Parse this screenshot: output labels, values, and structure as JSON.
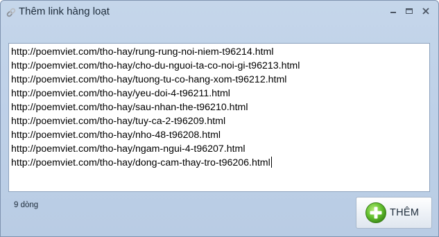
{
  "window": {
    "title": "Thêm link hàng loạt",
    "icon": "link-icon"
  },
  "textarea": {
    "lines": [
      "http://poemviet.com/tho-hay/rung-rung-noi-niem-t96214.html",
      "http://poemviet.com/tho-hay/cho-du-nguoi-ta-co-noi-gi-t96213.html",
      "http://poemviet.com/tho-hay/tuong-tu-co-hang-xom-t96212.html",
      "http://poemviet.com/tho-hay/yeu-doi-4-t96211.html",
      "http://poemviet.com/tho-hay/sau-nhan-the-t96210.html",
      "http://poemviet.com/tho-hay/tuy-ca-2-t96209.html",
      "http://poemviet.com/tho-hay/nho-48-t96208.html",
      "http://poemviet.com/tho-hay/ngam-ngui-4-t96207.html",
      "http://poemviet.com/tho-hay/dong-cam-thay-tro-t96206.html"
    ]
  },
  "status": {
    "line_count": "9 dòng"
  },
  "add_button": {
    "label": "THÊM",
    "icon": "plus-circle-icon"
  },
  "colors": {
    "window_bg": "#c1d3e8",
    "button_icon_green": "#5bb82f"
  }
}
